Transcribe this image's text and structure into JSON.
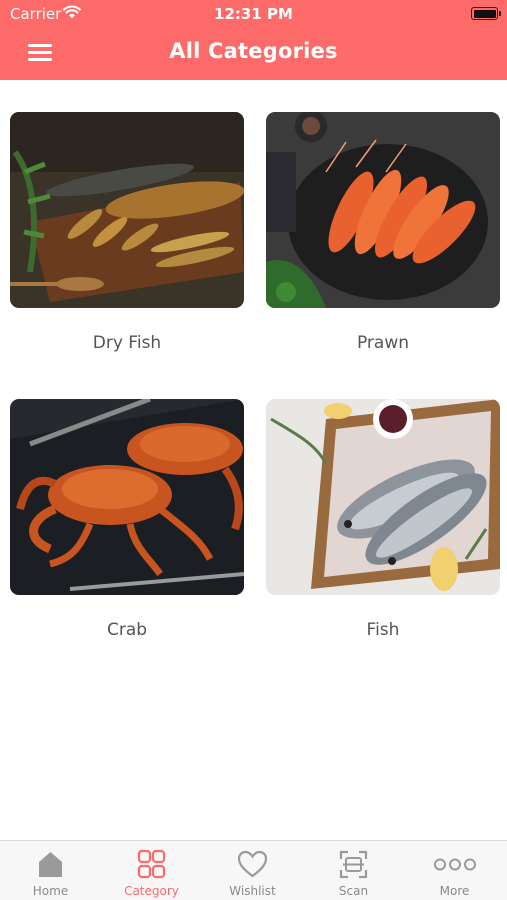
{
  "status_bar": {
    "carrier": "Carrier",
    "time": "12:31 PM"
  },
  "header": {
    "title": "All Categories",
    "menu_icon": "hamburger-menu-icon"
  },
  "categories": [
    {
      "label": "Dry Fish",
      "image": "dry-fish-photo"
    },
    {
      "label": "Prawn",
      "image": "prawn-photo"
    },
    {
      "label": "Crab",
      "image": "crab-photo"
    },
    {
      "label": "Fish",
      "image": "fish-photo"
    }
  ],
  "tab_bar": {
    "active": "Category",
    "active_color": "#fd6a6a",
    "items": [
      {
        "label": "Home",
        "icon": "home-icon"
      },
      {
        "label": "Category",
        "icon": "grid-icon"
      },
      {
        "label": "Wishlist",
        "icon": "heart-icon"
      },
      {
        "label": "Scan",
        "icon": "scan-icon"
      },
      {
        "label": "More",
        "icon": "more-dots-icon"
      }
    ]
  },
  "colors": {
    "brand": "#fd6a6a",
    "text": "#555555",
    "tab_inactive": "#8a8a8a"
  }
}
